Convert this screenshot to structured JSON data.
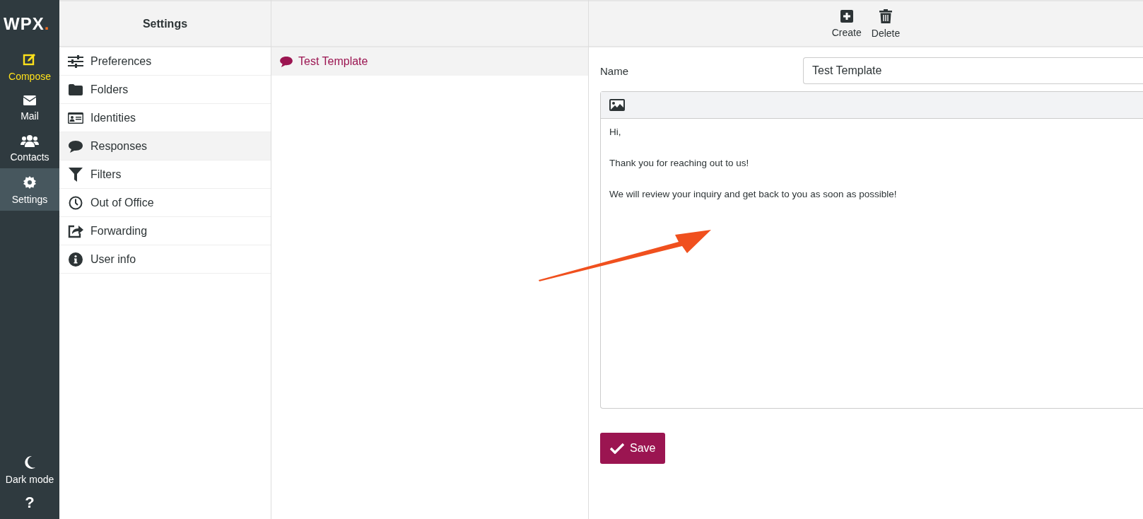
{
  "logo": {
    "text": "WPX",
    "dot": "."
  },
  "nav": [
    {
      "label": "Compose",
      "kind": "accent",
      "selected": false
    },
    {
      "label": "Mail",
      "kind": "normal",
      "selected": false
    },
    {
      "label": "Contacts",
      "kind": "normal",
      "selected": false
    },
    {
      "label": "Settings",
      "kind": "normal",
      "selected": true
    }
  ],
  "nav_bottom": [
    {
      "label": "Dark mode"
    },
    {
      "label": "?"
    }
  ],
  "settings": {
    "title": "Settings",
    "items": [
      {
        "label": "Preferences",
        "selected": false
      },
      {
        "label": "Folders",
        "selected": false
      },
      {
        "label": "Identities",
        "selected": false
      },
      {
        "label": "Responses",
        "selected": true
      },
      {
        "label": "Filters",
        "selected": false
      },
      {
        "label": "Out of Office",
        "selected": false
      },
      {
        "label": "Forwarding",
        "selected": false
      },
      {
        "label": "User info",
        "selected": false
      }
    ]
  },
  "responses": [
    {
      "label": "Test Template",
      "selected": true
    }
  ],
  "toolbar": [
    {
      "label": "Create"
    },
    {
      "label": "Delete"
    }
  ],
  "form": {
    "name_label": "Name",
    "name_value": "Test Template",
    "body": [
      "Hi,",
      "Thank you for reaching out to us!",
      "We will review your inquiry and get back to you as soon as possible!"
    ],
    "save": "Save"
  }
}
